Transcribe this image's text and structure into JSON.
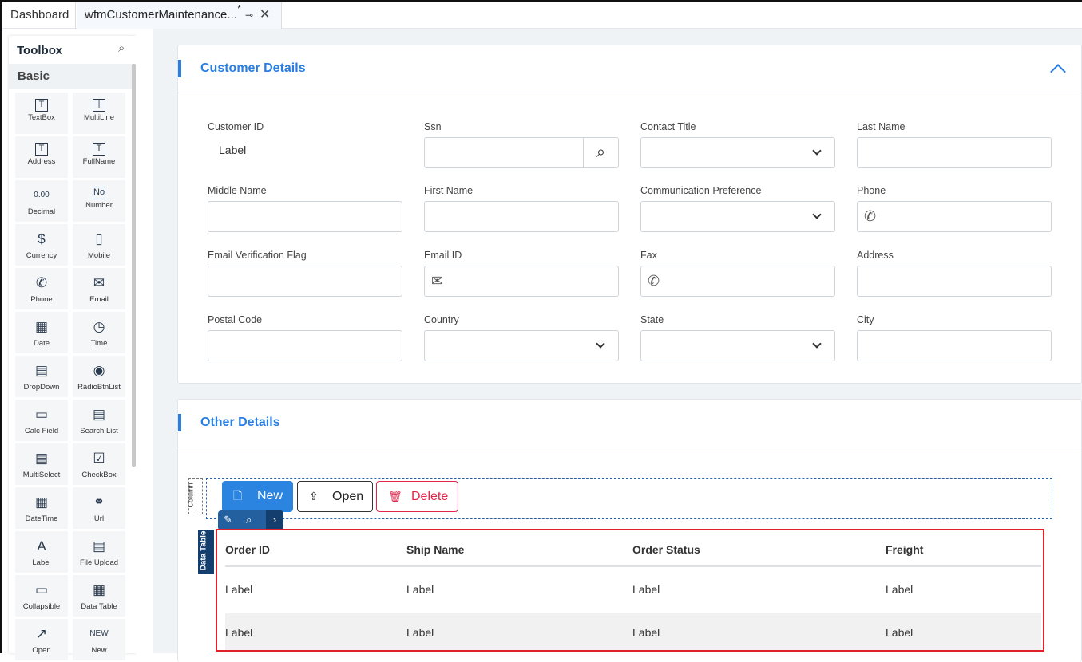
{
  "tabs": [
    {
      "label": "Dashboard"
    },
    {
      "label": "wfmCustomerMaintenance...",
      "modified": "*"
    }
  ],
  "toolbox": {
    "title": "Toolbox",
    "section": "Basic",
    "items": [
      {
        "label": "TextBox",
        "icon": "T"
      },
      {
        "label": "MultiLine",
        "icon": "|||"
      },
      {
        "label": "Address",
        "icon": "T"
      },
      {
        "label": "FullName",
        "icon": "T"
      },
      {
        "label": "Decimal",
        "icon": "0.00"
      },
      {
        "label": "Number",
        "icon": "No"
      },
      {
        "label": "Currency",
        "icon": "$"
      },
      {
        "label": "Mobile",
        "icon": "▯"
      },
      {
        "label": "Phone",
        "icon": "✆"
      },
      {
        "label": "Email",
        "icon": "✉"
      },
      {
        "label": "Date",
        "icon": "▦"
      },
      {
        "label": "Time",
        "icon": "◷"
      },
      {
        "label": "DropDown",
        "icon": "▤"
      },
      {
        "label": "RadioBtnList",
        "icon": "◉"
      },
      {
        "label": "Calc Field",
        "icon": "▭"
      },
      {
        "label": "Search List",
        "icon": "▤"
      },
      {
        "label": "MultiSelect",
        "icon": "▤"
      },
      {
        "label": "CheckBox",
        "icon": "☑"
      },
      {
        "label": "DateTime",
        "icon": "▦"
      },
      {
        "label": "Url",
        "icon": "⚭"
      },
      {
        "label": "Label",
        "icon": "A"
      },
      {
        "label": "File Upload",
        "icon": "▤"
      },
      {
        "label": "Collapsible",
        "icon": "▭"
      },
      {
        "label": "Data Table",
        "icon": "▦"
      },
      {
        "label": "Open",
        "icon": "↗"
      },
      {
        "label": "New",
        "icon": "NEW"
      }
    ]
  },
  "customer": {
    "title": "Customer Details",
    "fields": [
      {
        "label": "Customer ID",
        "value": "Label",
        "type": "label"
      },
      {
        "label": "Ssn",
        "type": "search"
      },
      {
        "label": "Contact Title",
        "type": "select"
      },
      {
        "label": "Last Name",
        "type": "text"
      },
      {
        "label": "Middle Name",
        "type": "text"
      },
      {
        "label": "First Name",
        "type": "text"
      },
      {
        "label": "Communication Preference",
        "type": "select"
      },
      {
        "label": "Phone",
        "type": "phone"
      },
      {
        "label": "Email Verification Flag",
        "type": "text"
      },
      {
        "label": "Email ID",
        "type": "email"
      },
      {
        "label": "Fax",
        "type": "phone"
      },
      {
        "label": "Address",
        "type": "text"
      },
      {
        "label": "Postal Code",
        "type": "text"
      },
      {
        "label": "Country",
        "type": "select"
      },
      {
        "label": "State",
        "type": "select"
      },
      {
        "label": "City",
        "type": "text"
      }
    ]
  },
  "other": {
    "title": "Other Details",
    "column_label": "Column",
    "datatable_label": "Data Table",
    "buttons": {
      "new": "New",
      "open": "Open",
      "delete": "Delete"
    },
    "table": {
      "headers": [
        "Order ID",
        "Ship Name",
        "Order Status",
        "Freight"
      ],
      "rows": [
        [
          "Label",
          "Label",
          "Label",
          "Label"
        ],
        [
          "Label",
          "Label",
          "Label",
          "Label"
        ]
      ]
    }
  }
}
